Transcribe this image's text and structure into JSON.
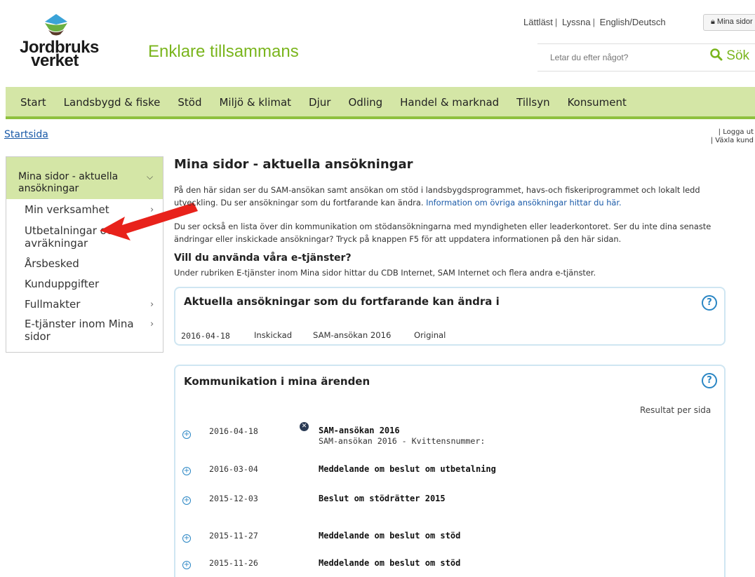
{
  "header": {
    "logo_line1": "Jordbruks",
    "logo_line2": "verket",
    "tagline": "Enklare tillsammans",
    "toplinks": [
      "Lättläst",
      "Lyssna",
      "English/Deutsch"
    ],
    "mina_sidor_btn": "Mina sidor",
    "search_placeholder": "Letar du efter något?",
    "search_button": "Sök"
  },
  "nav": {
    "items": [
      "Start",
      "Landsbygd & fiske",
      "Stöd",
      "Miljö & klimat",
      "Djur",
      "Odling",
      "Handel & marknad",
      "Tillsyn",
      "Konsument"
    ]
  },
  "breadcrumb": "Startsida",
  "account_links": [
    "| Logga ut",
    "| Växla kund"
  ],
  "sidebar": {
    "active": "Mina sidor - aktuella ansökningar",
    "items": [
      {
        "label": "Min verksamhet",
        "chevron": "›"
      },
      {
        "label": "Utbetalningar och avräkningar",
        "chevron": ""
      },
      {
        "label": "Årsbesked",
        "chevron": ""
      },
      {
        "label": "Kunduppgifter",
        "chevron": ""
      },
      {
        "label": "Fullmakter",
        "chevron": "›"
      },
      {
        "label": "E-tjänster inom Mina sidor",
        "chevron": "›"
      }
    ]
  },
  "main": {
    "title": "Mina sidor - aktuella ansökningar",
    "intro1": "På den här sidan ser du SAM-ansökan samt ansökan om stöd i landsbygdsprogrammet, havs-och fiskeriprogrammet och lokalt ledd utveckling. Du ser ansökningar som du fortfarande kan ändra.",
    "intro1_link": "Information om övriga ansökningar hittar du här.",
    "intro2": "Du ser också en lista över din kommunikation om stödansökningarna med myndigheten eller leaderkontoret. Ser du inte dina senaste ändringar eller inskickade ansökningar? Tryck på knappen F5 för att uppdatera informationen på den här sidan.",
    "eservices_heading": "Vill du använda våra e-tjänster?",
    "eservices_text": "Under rubriken E-tjänster inom Mina sidor hittar du CDB Internet, SAM Internet och flera andra e-tjänster."
  },
  "applications_box": {
    "title": "Aktuella ansökningar som du fortfarande kan ändra i",
    "help": "?",
    "row": {
      "date": "2016-04-18",
      "status": "Inskickad",
      "name": "SAM-ansökan 2016",
      "version": "Original"
    }
  },
  "communication_box": {
    "title": "Kommunikation i mina ärenden",
    "help": "?",
    "per_page_label": "Resultat per sida",
    "rows": [
      {
        "date": "2016-04-18",
        "subject": "SAM-ansökan 2016",
        "detail": "SAM-ansökan 2016 - Kvittensnummer:"
      },
      {
        "date": "2016-03-04",
        "subject": "Meddelande om beslut om utbetalning",
        "detail": ""
      },
      {
        "date": "2015-12-03",
        "subject": "Beslut om stödrätter 2015",
        "detail": ""
      },
      {
        "date": "2015-11-27",
        "subject": "Meddelande om beslut om stöd",
        "detail": ""
      },
      {
        "date": "2015-11-26",
        "subject": "Meddelande om beslut om stöd",
        "detail": ""
      }
    ]
  },
  "colors": {
    "brand_green": "#7ab51d",
    "nav_bg": "#d4e6a6",
    "link_blue": "#1a5aa8",
    "help_blue": "#2a86c4",
    "annotation_arrow": "#e8221b"
  }
}
